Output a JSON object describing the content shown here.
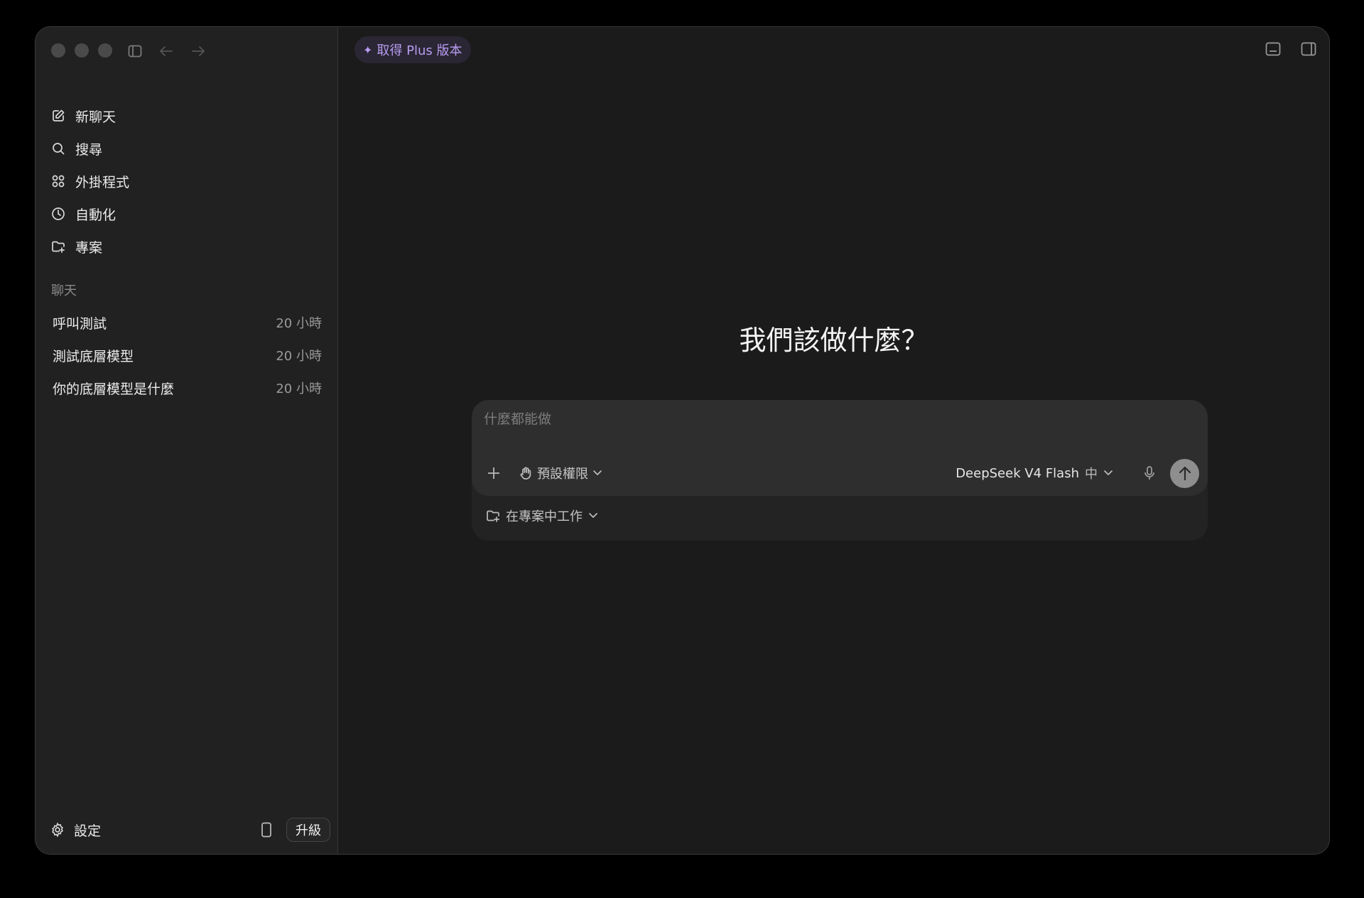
{
  "window": {
    "nav_back_icon": "arrow-left-icon",
    "nav_forward_icon": "arrow-right-icon"
  },
  "sidebar": {
    "nav": [
      {
        "label": "新聊天",
        "icon": "edit-icon"
      },
      {
        "label": "搜尋",
        "icon": "search-icon"
      },
      {
        "label": "外掛程式",
        "icon": "grid-icon"
      },
      {
        "label": "自動化",
        "icon": "clock-icon"
      },
      {
        "label": "專案",
        "icon": "folder-plus-icon"
      }
    ],
    "section_title": "聊天",
    "chats": [
      {
        "title": "呼叫測試",
        "time": "20 小時"
      },
      {
        "title": "測試底層模型",
        "time": "20 小時"
      },
      {
        "title": "你的底層模型是什麼",
        "time": "20 小時"
      }
    ],
    "settings_label": "設定",
    "upgrade_label": "升級"
  },
  "main": {
    "plus_label": "取得 Plus 版本",
    "heading": "我們該做什麼？",
    "composer": {
      "placeholder": "什麼都能做",
      "permission_label": "預設權限",
      "model_label": "DeepSeek V4 Flash",
      "effort_label": "中",
      "project_label": "在專案中工作"
    }
  },
  "colors": {
    "accent": "#b89cf0",
    "background": "#1b1b1b",
    "sidebar": "#212121"
  }
}
